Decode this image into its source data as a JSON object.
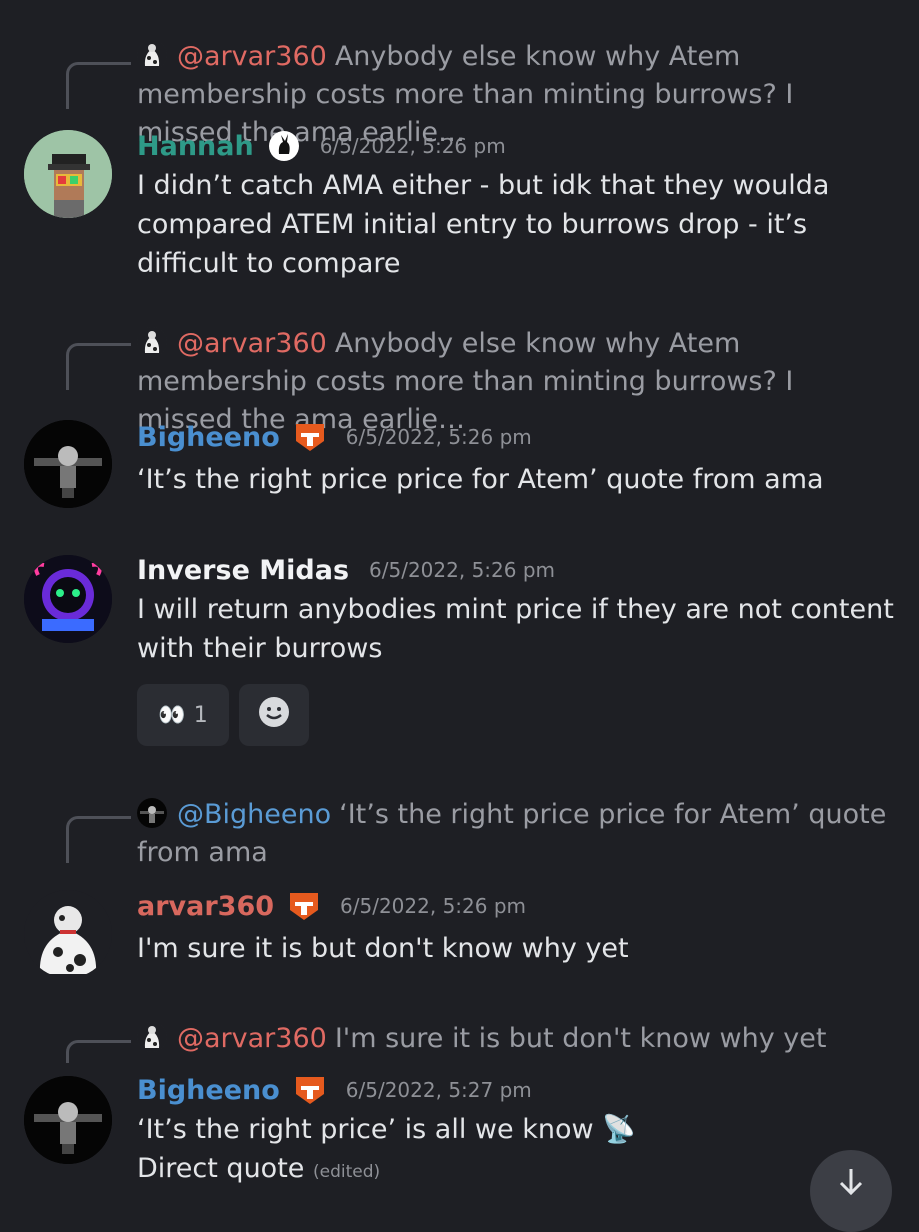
{
  "colors": {
    "background": "#1e1f24",
    "hannah": "#2e9a88",
    "bigheeno": "#4a8fd0",
    "arvar": "#d8685e",
    "mention_red": "#e06a63",
    "mention_blue": "#5a9bd5"
  },
  "messages": [
    {
      "reply_to_mention": "@arvar360",
      "reply_text": "Anybody else know why Atem membership costs more than minting burrows? I missed the ama earlie…",
      "author": "Hannah",
      "timestamp": "6/5/2022, 5:26 pm",
      "lines": [
        "I didn’t catch AMA either - but idk that they woulda compared ATEM initial entry to burrows drop - it’s difficult to compare"
      ]
    },
    {
      "reply_to_mention": "@arvar360",
      "reply_text": "Anybody else know why Atem membership costs more than minting burrows? I missed the ama earlie…",
      "author": "Bigheeno",
      "timestamp": "6/5/2022, 5:26 pm",
      "lines": [
        "‘It’s the right price price for Atem’ quote from ama"
      ]
    },
    {
      "author": "Inverse Midas",
      "timestamp": "6/5/2022, 5:26 pm",
      "lines": [
        "I will return anybodies mint price if they are not content with their burrows"
      ],
      "reactions": [
        {
          "emoji": "👀",
          "count": "1"
        },
        {
          "emoji": "add-reaction-icon",
          "count": ""
        }
      ]
    },
    {
      "reply_to_mention": "@Bigheeno",
      "reply_text": "‘It’s the right price price for Atem’ quote from ama",
      "author": "arvar360",
      "timestamp": "6/5/2022, 5:26 pm",
      "lines": [
        "I'm sure it is but don't know why yet"
      ]
    },
    {
      "reply_to_mention": "@arvar360",
      "reply_text": "I'm sure it is but don't know why yet",
      "author": "Bigheeno",
      "timestamp": "6/5/2022, 5:27 pm",
      "lines": [
        "‘It’s the right price’ is all we know 📡",
        "Direct quote"
      ],
      "edited_label": "(edited)"
    }
  ],
  "scroll_button_icon": "arrow-down-icon"
}
